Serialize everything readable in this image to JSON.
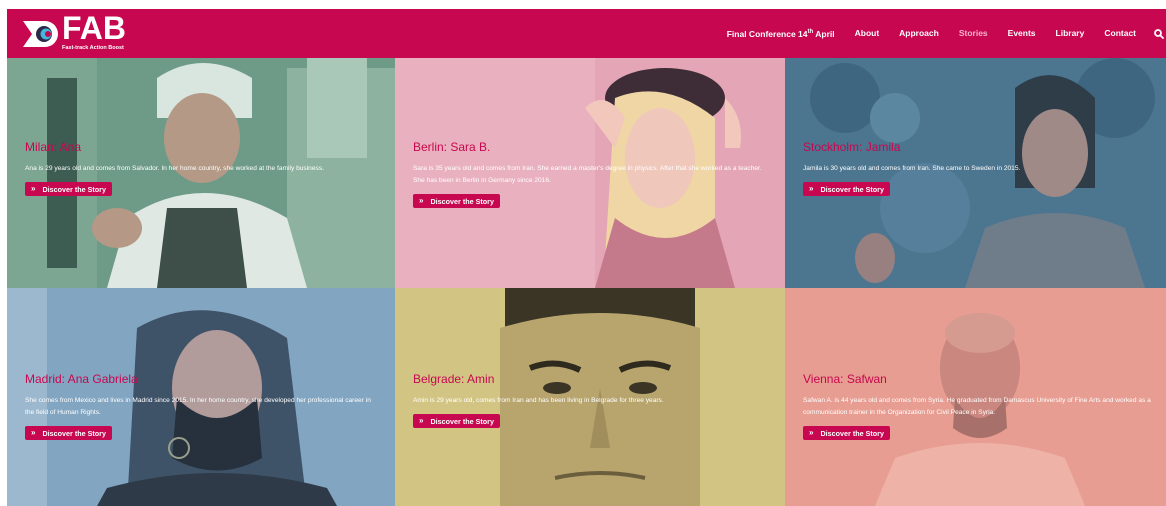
{
  "brand": {
    "name": "FAB",
    "tagline": "Fast-track Action Boost",
    "color": "#c7074f"
  },
  "nav": {
    "items": [
      {
        "label": "Final Conference 14",
        "sup": "th",
        "label_tail": " April"
      },
      {
        "label": "About"
      },
      {
        "label": "Approach"
      },
      {
        "label": "Stories"
      },
      {
        "label": "Events"
      },
      {
        "label": "Library"
      },
      {
        "label": "Contact"
      }
    ],
    "active": "Stories",
    "search_icon": "search-icon"
  },
  "stories": [
    {
      "title": "Milan: Ana",
      "text": "Ana is 29 years old and comes from Salvador. In her home country, she worked at the family business.",
      "button": "Discover the Story",
      "tint": "#6b9a86"
    },
    {
      "title": "Berlin: Sara B.",
      "text": "Sara is 35 years old and comes from Iran. She earned a master's degree in physics. After that she worked as a teacher. She has been in Berlin in Germany since 2016.",
      "button": "Discover the Story",
      "tint": "#e2a3b3"
    },
    {
      "title": "Stockholm: Jamila",
      "text": "Jamila is 30 years old and comes from Iran. She came to Sweden in 2015.",
      "button": "Discover the Story",
      "tint": "#4d7690"
    },
    {
      "title": "Madrid: Ana Gabriela",
      "text": "She comes from Mexico and lives in Madrid since 2015. In her home country, she developed her professional career in the field of Human Rights.",
      "button": "Discover the Story",
      "tint": "#7ea2be"
    },
    {
      "title": "Belgrade: Amin",
      "text": "Amin is 29 years old, comes from Iran and has been living in Belgrade for three years.",
      "button": "Discover the Story",
      "tint": "#cfc381"
    },
    {
      "title": "Vienna: Safwan",
      "text": "Safwan A. is 44 years old and comes from Syria. He graduated from Damascus University of Fine Arts and worked as a communication trainer in the Organization for Civil Peace in Syria.",
      "button": "Discover the Story",
      "tint": "#e69a8f"
    }
  ]
}
